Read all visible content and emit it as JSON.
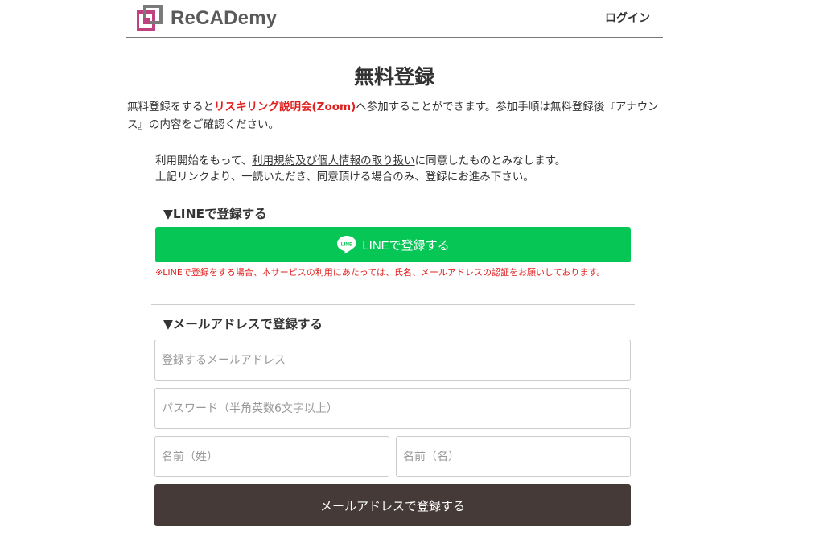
{
  "header": {
    "brand": "ReCADemy",
    "login_label": "ログイン",
    "brand_color": "#c0417f"
  },
  "page": {
    "title": "無料登録",
    "intro_before": "無料登録をすると",
    "intro_highlight": "リスキリング説明会(Zoom)",
    "intro_after": "へ参加することができます。参加手順は無料登録後『アナウンス』の内容をご確認ください。"
  },
  "terms": {
    "line1_before": "利用開始をもって、",
    "line1_link": "利用規約及び個人情報の取り扱い",
    "line1_after": "に同意したものとみなします。",
    "line2": "上記リンクより、一読いただき、同意頂ける場合のみ、登録にお進み下さい。"
  },
  "line_section": {
    "title": "▼LINEで登録する",
    "button_label": "LINEで登録する",
    "icon": "line-logo-icon",
    "icon_text": "LINE",
    "note": "※LINEで登録をする場合、本サービスの利用にあたっては、氏名、メールアドレスの認証をお願いしております。",
    "color": "#06c755"
  },
  "mail_section": {
    "title": "▼メールアドレスで登録する",
    "email_placeholder": "登録するメールアドレス",
    "password_placeholder": "パスワード（半角英数6文字以上）",
    "last_name_placeholder": "名前（姓）",
    "first_name_placeholder": "名前（名）",
    "submit_label": "メールアドレスで登録する",
    "button_color": "#453a38"
  }
}
